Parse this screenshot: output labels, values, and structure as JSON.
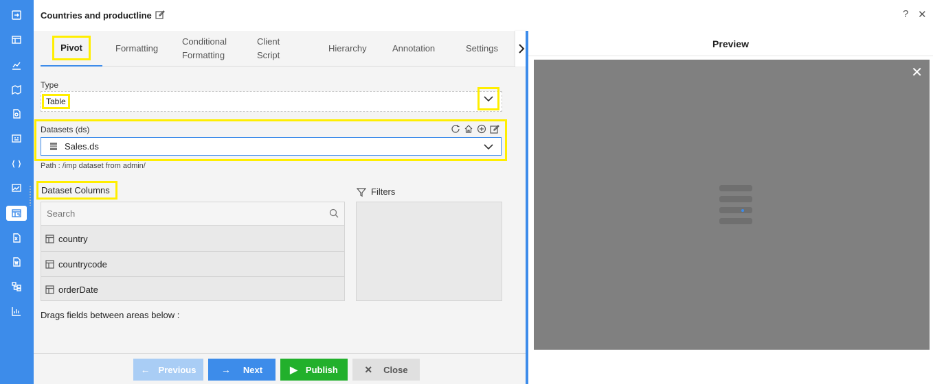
{
  "header": {
    "title": "Countries and productline",
    "help_icon": "?",
    "close_icon": "✕"
  },
  "rail": {
    "items": [
      "export-icon",
      "table-icon",
      "chart-icon",
      "map-icon",
      "document-icon",
      "card-icon",
      "code-icon",
      "image-chart-icon",
      "pivot-icon",
      "excel-icon",
      "word-icon",
      "hierarchy-icon",
      "bar-chart-icon"
    ],
    "active": "pivot-icon"
  },
  "tabs": [
    {
      "label": "Pivot"
    },
    {
      "label": "Formatting"
    },
    {
      "label": "Conditional Formatting"
    },
    {
      "label": "Client Script"
    },
    {
      "label": "Hierarchy"
    },
    {
      "label": "Annotation"
    },
    {
      "label": "Settings"
    }
  ],
  "type": {
    "label": "Type",
    "value": "Table"
  },
  "datasets": {
    "label": "Datasets (ds)",
    "value": "Sales.ds",
    "path": "Path : /imp dataset from admin/"
  },
  "columns": {
    "label": "Dataset Columns",
    "search_placeholder": "Search",
    "items": [
      "country",
      "countrycode",
      "orderDate"
    ]
  },
  "filters": {
    "label": "Filters"
  },
  "drag_hint": "Drags fields between areas below :",
  "buttons": {
    "previous": "Previous",
    "next": "Next",
    "publish": "Publish",
    "close": "Close"
  },
  "preview": {
    "title": "Preview",
    "close_icon": "✕"
  },
  "colors": {
    "accent": "#3d8cea",
    "publish": "#22b02c",
    "highlight": "#ffee00",
    "preview_bg": "#808080"
  }
}
